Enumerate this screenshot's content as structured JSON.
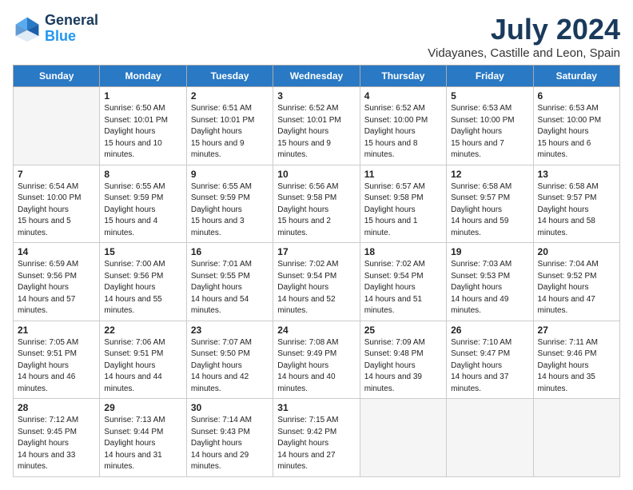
{
  "logo": {
    "line1": "General",
    "line2": "Blue"
  },
  "title": "July 2024",
  "location": "Vidayanes, Castille and Leon, Spain",
  "weekdays": [
    "Sunday",
    "Monday",
    "Tuesday",
    "Wednesday",
    "Thursday",
    "Friday",
    "Saturday"
  ],
  "weeks": [
    [
      {
        "num": "",
        "empty": true
      },
      {
        "num": "1",
        "sunrise": "6:50 AM",
        "sunset": "10:01 PM",
        "daylight": "15 hours and 10 minutes."
      },
      {
        "num": "2",
        "sunrise": "6:51 AM",
        "sunset": "10:01 PM",
        "daylight": "15 hours and 9 minutes."
      },
      {
        "num": "3",
        "sunrise": "6:52 AM",
        "sunset": "10:01 PM",
        "daylight": "15 hours and 9 minutes."
      },
      {
        "num": "4",
        "sunrise": "6:52 AM",
        "sunset": "10:00 PM",
        "daylight": "15 hours and 8 minutes."
      },
      {
        "num": "5",
        "sunrise": "6:53 AM",
        "sunset": "10:00 PM",
        "daylight": "15 hours and 7 minutes."
      },
      {
        "num": "6",
        "sunrise": "6:53 AM",
        "sunset": "10:00 PM",
        "daylight": "15 hours and 6 minutes."
      }
    ],
    [
      {
        "num": "7",
        "sunrise": "6:54 AM",
        "sunset": "10:00 PM",
        "daylight": "15 hours and 5 minutes."
      },
      {
        "num": "8",
        "sunrise": "6:55 AM",
        "sunset": "9:59 PM",
        "daylight": "15 hours and 4 minutes."
      },
      {
        "num": "9",
        "sunrise": "6:55 AM",
        "sunset": "9:59 PM",
        "daylight": "15 hours and 3 minutes."
      },
      {
        "num": "10",
        "sunrise": "6:56 AM",
        "sunset": "9:58 PM",
        "daylight": "15 hours and 2 minutes."
      },
      {
        "num": "11",
        "sunrise": "6:57 AM",
        "sunset": "9:58 PM",
        "daylight": "15 hours and 1 minute."
      },
      {
        "num": "12",
        "sunrise": "6:58 AM",
        "sunset": "9:57 PM",
        "daylight": "14 hours and 59 minutes."
      },
      {
        "num": "13",
        "sunrise": "6:58 AM",
        "sunset": "9:57 PM",
        "daylight": "14 hours and 58 minutes."
      }
    ],
    [
      {
        "num": "14",
        "sunrise": "6:59 AM",
        "sunset": "9:56 PM",
        "daylight": "14 hours and 57 minutes."
      },
      {
        "num": "15",
        "sunrise": "7:00 AM",
        "sunset": "9:56 PM",
        "daylight": "14 hours and 55 minutes."
      },
      {
        "num": "16",
        "sunrise": "7:01 AM",
        "sunset": "9:55 PM",
        "daylight": "14 hours and 54 minutes."
      },
      {
        "num": "17",
        "sunrise": "7:02 AM",
        "sunset": "9:54 PM",
        "daylight": "14 hours and 52 minutes."
      },
      {
        "num": "18",
        "sunrise": "7:02 AM",
        "sunset": "9:54 PM",
        "daylight": "14 hours and 51 minutes."
      },
      {
        "num": "19",
        "sunrise": "7:03 AM",
        "sunset": "9:53 PM",
        "daylight": "14 hours and 49 minutes."
      },
      {
        "num": "20",
        "sunrise": "7:04 AM",
        "sunset": "9:52 PM",
        "daylight": "14 hours and 47 minutes."
      }
    ],
    [
      {
        "num": "21",
        "sunrise": "7:05 AM",
        "sunset": "9:51 PM",
        "daylight": "14 hours and 46 minutes."
      },
      {
        "num": "22",
        "sunrise": "7:06 AM",
        "sunset": "9:51 PM",
        "daylight": "14 hours and 44 minutes."
      },
      {
        "num": "23",
        "sunrise": "7:07 AM",
        "sunset": "9:50 PM",
        "daylight": "14 hours and 42 minutes."
      },
      {
        "num": "24",
        "sunrise": "7:08 AM",
        "sunset": "9:49 PM",
        "daylight": "14 hours and 40 minutes."
      },
      {
        "num": "25",
        "sunrise": "7:09 AM",
        "sunset": "9:48 PM",
        "daylight": "14 hours and 39 minutes."
      },
      {
        "num": "26",
        "sunrise": "7:10 AM",
        "sunset": "9:47 PM",
        "daylight": "14 hours and 37 minutes."
      },
      {
        "num": "27",
        "sunrise": "7:11 AM",
        "sunset": "9:46 PM",
        "daylight": "14 hours and 35 minutes."
      }
    ],
    [
      {
        "num": "28",
        "sunrise": "7:12 AM",
        "sunset": "9:45 PM",
        "daylight": "14 hours and 33 minutes."
      },
      {
        "num": "29",
        "sunrise": "7:13 AM",
        "sunset": "9:44 PM",
        "daylight": "14 hours and 31 minutes."
      },
      {
        "num": "30",
        "sunrise": "7:14 AM",
        "sunset": "9:43 PM",
        "daylight": "14 hours and 29 minutes."
      },
      {
        "num": "31",
        "sunrise": "7:15 AM",
        "sunset": "9:42 PM",
        "daylight": "14 hours and 27 minutes."
      },
      {
        "num": "",
        "empty": true
      },
      {
        "num": "",
        "empty": true
      },
      {
        "num": "",
        "empty": true
      }
    ]
  ]
}
